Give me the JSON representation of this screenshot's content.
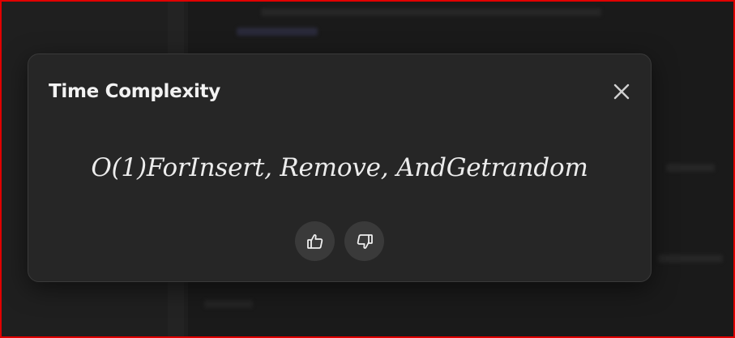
{
  "dialog": {
    "title": "Time Complexity",
    "close_icon": "close-icon",
    "formula": "O(1)ForInsert, Remove, AndGetrandom",
    "feedback": {
      "thumbs_up_icon": "thumbs-up-icon",
      "thumbs_down_icon": "thumbs-down-icon"
    }
  },
  "colors": {
    "page_background": "#1a1a1a",
    "dialog_background": "#262626",
    "button_background": "#3a3a3a",
    "text": "#f2f2f2",
    "frame_border": "#e00000"
  }
}
